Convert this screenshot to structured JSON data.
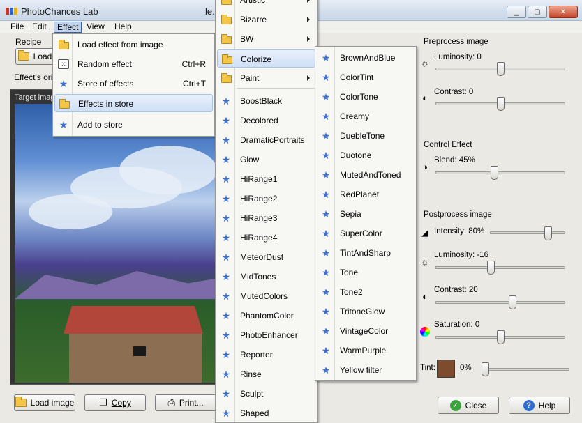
{
  "window": {
    "title": "PhotoChances Lab",
    "document_title_partial": "le."
  },
  "menubar": [
    "File",
    "Edit",
    "Effect",
    "View",
    "Help"
  ],
  "left": {
    "recipe_label": "Recipe",
    "load_button": "Load",
    "origin_label": "Effect's orig",
    "target_label": "Target imag",
    "load_image_button": "Load image",
    "copy_button": "Copy",
    "print_button": "Print..."
  },
  "effect_menu": [
    {
      "label": "Load effect from image",
      "shortcut": "",
      "icon": "folder-icon"
    },
    {
      "label": "Random effect",
      "shortcut": "Ctrl+R",
      "icon": "dice-icon"
    },
    {
      "label": "Store of effects",
      "shortcut": "Ctrl+T",
      "icon": "star-icon"
    },
    {
      "label": "Effects in store",
      "shortcut": "",
      "icon": "folder-icon"
    },
    {
      "label": "Add to store",
      "shortcut": "",
      "icon": "star-add-icon"
    }
  ],
  "store_menu": [
    {
      "label": "Artistic",
      "submenu": true,
      "icon": "folder-icon"
    },
    {
      "label": "Bizarre",
      "submenu": true,
      "icon": "folder-icon"
    },
    {
      "label": "BW",
      "submenu": true,
      "icon": "folder-icon"
    },
    {
      "label": "Colorize",
      "submenu": false,
      "icon": "folder-icon"
    },
    {
      "label": "Paint",
      "submenu": true,
      "icon": "folder-icon"
    },
    {
      "label": "BoostBlack",
      "submenu": false,
      "icon": "star-icon"
    },
    {
      "label": "Decolored",
      "submenu": false,
      "icon": "star-icon"
    },
    {
      "label": "DramaticPortraits",
      "submenu": false,
      "icon": "star-icon"
    },
    {
      "label": "Glow",
      "submenu": false,
      "icon": "star-icon"
    },
    {
      "label": "HiRange1",
      "submenu": false,
      "icon": "star-icon"
    },
    {
      "label": "HiRange2",
      "submenu": false,
      "icon": "star-icon"
    },
    {
      "label": "HiRange3",
      "submenu": false,
      "icon": "star-icon"
    },
    {
      "label": "HiRange4",
      "submenu": false,
      "icon": "star-icon"
    },
    {
      "label": "MeteorDust",
      "submenu": false,
      "icon": "star-icon"
    },
    {
      "label": "MidTones",
      "submenu": false,
      "icon": "star-icon"
    },
    {
      "label": "MutedColors",
      "submenu": false,
      "icon": "star-icon"
    },
    {
      "label": "PhantomColor",
      "submenu": false,
      "icon": "star-icon"
    },
    {
      "label": "PhotoEnhancer",
      "submenu": false,
      "icon": "star-icon"
    },
    {
      "label": "Reporter",
      "submenu": false,
      "icon": "star-icon"
    },
    {
      "label": "Rinse",
      "submenu": false,
      "icon": "star-icon"
    },
    {
      "label": "Sculpt",
      "submenu": false,
      "icon": "star-icon"
    },
    {
      "label": "Shaped",
      "submenu": false,
      "icon": "star-icon"
    }
  ],
  "colorize_menu": [
    "BrownAndBlue",
    "ColorTint",
    "ColorTone",
    "Creamy",
    "DuebleTone",
    "Duotone",
    "MutedAndToned",
    "RedPlanet",
    "Sepia",
    "SuperColor",
    "TintAndSharp",
    "Tone",
    "Tone2",
    "TritoneGlow",
    "VintageColor",
    "WarmPurple",
    "Yellow filter"
  ],
  "right": {
    "preprocess_title": "Preprocess image",
    "pre_luminosity": {
      "label": "Luminosity: 0",
      "value": 0,
      "min": -100,
      "max": 100
    },
    "pre_contrast": {
      "label": "Contrast: 0",
      "value": 0,
      "min": -100,
      "max": 100
    },
    "control_title": "Control Effect",
    "blend": {
      "label": "Blend: 45%",
      "value": 45,
      "min": 0,
      "max": 100
    },
    "postprocess_title": "Postprocess image",
    "intensity": {
      "label": "Intensity: 80%",
      "value": 80,
      "min": 0,
      "max": 100
    },
    "post_luminosity": {
      "label": "Luminosity: -16",
      "value": -16,
      "min": -100,
      "max": 100
    },
    "post_contrast": {
      "label": "Contrast: 20",
      "value": 20,
      "min": -100,
      "max": 100
    },
    "saturation": {
      "label": "Saturation: 0",
      "value": 0,
      "min": -100,
      "max": 100
    },
    "tint": {
      "label": "Tint:",
      "percent_label": "0%",
      "value": 0,
      "swatch_color": "#7d4b2e"
    }
  },
  "buttons": {
    "close": "Close",
    "help": "Help"
  },
  "colors": {
    "menu_highlight": "#cfdff6",
    "star": "#3d6fcf",
    "folder": "#f3c64a"
  }
}
